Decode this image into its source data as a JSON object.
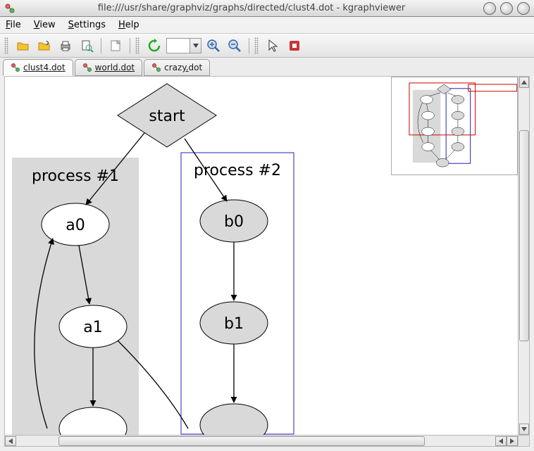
{
  "window": {
    "title": "file:///usr/share/graphviz/graphs/directed/clust4.dot - kgraphviewer"
  },
  "menu": {
    "file": "File",
    "view": "View",
    "settings": "Settings",
    "help": "Help"
  },
  "tabs": [
    {
      "label": "clust4.dot",
      "active": true
    },
    {
      "label": "world.dot",
      "active": false
    },
    {
      "label": "crazy.dot",
      "active": false
    }
  ],
  "graph": {
    "start": "start",
    "cluster1_label": "process #1",
    "cluster2_label": "process #2",
    "a0": "a0",
    "a1": "a1",
    "b0": "b0",
    "b1": "b1"
  }
}
